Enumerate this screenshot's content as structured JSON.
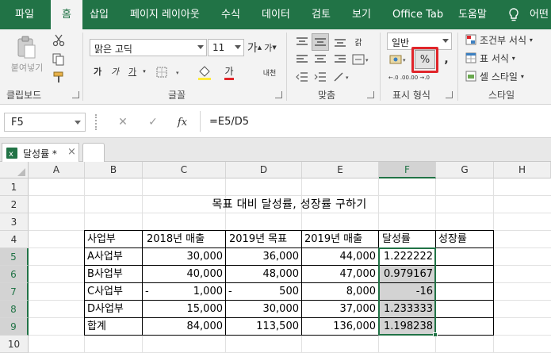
{
  "ribbon_tabs": [
    {
      "label": "파일"
    },
    {
      "label": "홈"
    },
    {
      "label": "삽입"
    },
    {
      "label": "페이지 레이아웃"
    },
    {
      "label": "수식"
    },
    {
      "label": "데이터"
    },
    {
      "label": "검토"
    },
    {
      "label": "보기"
    },
    {
      "label": "Office Tab"
    },
    {
      "label": "도움말"
    },
    {
      "label": "어떤"
    }
  ],
  "clipboard": {
    "paste_label": "붙여넣기",
    "group_label": "클립보드"
  },
  "font": {
    "name": "맑은 고딕",
    "size": "11",
    "grow": "가",
    "shrink": "가",
    "bold": "가",
    "italic": "가",
    "underline": "가",
    "phonetic": "내천",
    "color_letter": "가",
    "group_label": "글꼴"
  },
  "alignment": {
    "wrap": "갉",
    "group_label": "맞춤"
  },
  "number": {
    "format": "일반",
    "percent_label": "%",
    "comma_label": ",",
    "inc_decimal": "←.0 .00",
    "dec_decimal": ".00 →.0",
    "group_label": "표시 형식"
  },
  "styles": {
    "conditional": "조건부 서식",
    "table": "표 서식",
    "cell": "셀 스타일",
    "group_label": "스타일"
  },
  "formula_bar": {
    "name_box": "F5",
    "cancel": "✕",
    "enter": "✓",
    "fx": "fx",
    "formula": "=E5/D5"
  },
  "sheet": {
    "tab_label": "달성률 *",
    "close": "×"
  },
  "columns": [
    "A",
    "B",
    "C",
    "D",
    "E",
    "F",
    "G",
    "H"
  ],
  "rows": [
    "1",
    "2",
    "3",
    "4",
    "5",
    "6",
    "7",
    "8",
    "9",
    "10"
  ],
  "table": {
    "title": "목표 대비 달성률, 성장률 구하기",
    "headers": [
      "사업부",
      "2018년 매출",
      "2019년 목표",
      "2019년 매출",
      "달성률",
      "성장률"
    ],
    "rows": [
      {
        "name": "A사업부",
        "c": "30,000",
        "d": "36,000",
        "e": "44,000",
        "f": "1.222222",
        "g": "",
        "c_dash": "",
        "d_dash": ""
      },
      {
        "name": "B사업부",
        "c": "40,000",
        "d": "48,000",
        "e": "47,000",
        "f": "0.979167",
        "g": "",
        "c_dash": "",
        "d_dash": ""
      },
      {
        "name": "C사업부",
        "c": "1,000",
        "d": "500",
        "e": "8,000",
        "f": "-16",
        "g": "",
        "c_dash": "-",
        "d_dash": "-"
      },
      {
        "name": "D사업부",
        "c": "15,000",
        "d": "30,000",
        "e": "37,000",
        "f": "1.233333",
        "g": "",
        "c_dash": "",
        "d_dash": ""
      },
      {
        "name": "합계",
        "c": "84,000",
        "d": "113,500",
        "e": "136,000",
        "f": "1.198238",
        "g": "",
        "c_dash": "",
        "d_dash": ""
      }
    ]
  },
  "colors": {
    "brand": "#217346",
    "selection_fill": "#d3d3d3",
    "highlight_box": "#e0252a"
  }
}
